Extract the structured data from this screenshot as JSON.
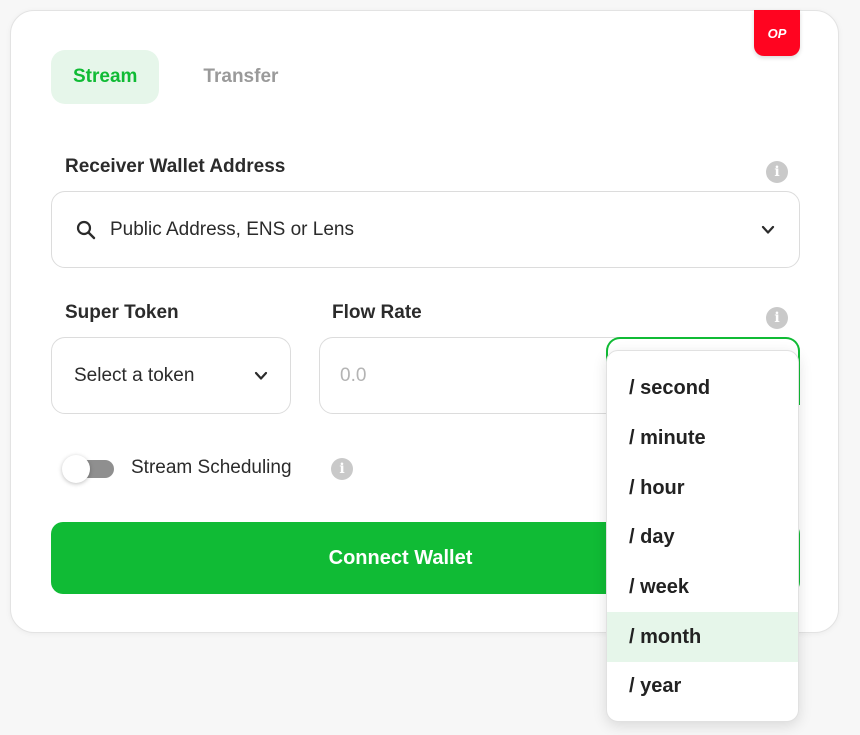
{
  "badge": {
    "text": "OP",
    "color": "#ff0420"
  },
  "tabs": [
    {
      "label": "Stream",
      "active": true
    },
    {
      "label": "Transfer",
      "active": false
    }
  ],
  "receiver": {
    "label": "Receiver Wallet Address",
    "placeholder": "Public Address, ENS or Lens",
    "icon": "search-icon"
  },
  "super_token": {
    "label": "Super Token",
    "value": "Select a token"
  },
  "flow_rate": {
    "label": "Flow Rate",
    "placeholder": "0.0"
  },
  "scheduling": {
    "label": "Stream Scheduling",
    "enabled": false
  },
  "connect_button": {
    "label": "Connect Wallet"
  },
  "time_units": {
    "options": [
      "/ second",
      "/ minute",
      "/ hour",
      "/ day",
      "/ week",
      "/ month",
      "/ year"
    ],
    "highlighted": "/ month"
  },
  "colors": {
    "accent": "#10bb35",
    "accent_light": "#e6f6ea",
    "info_icon": "#c9c9c9"
  }
}
